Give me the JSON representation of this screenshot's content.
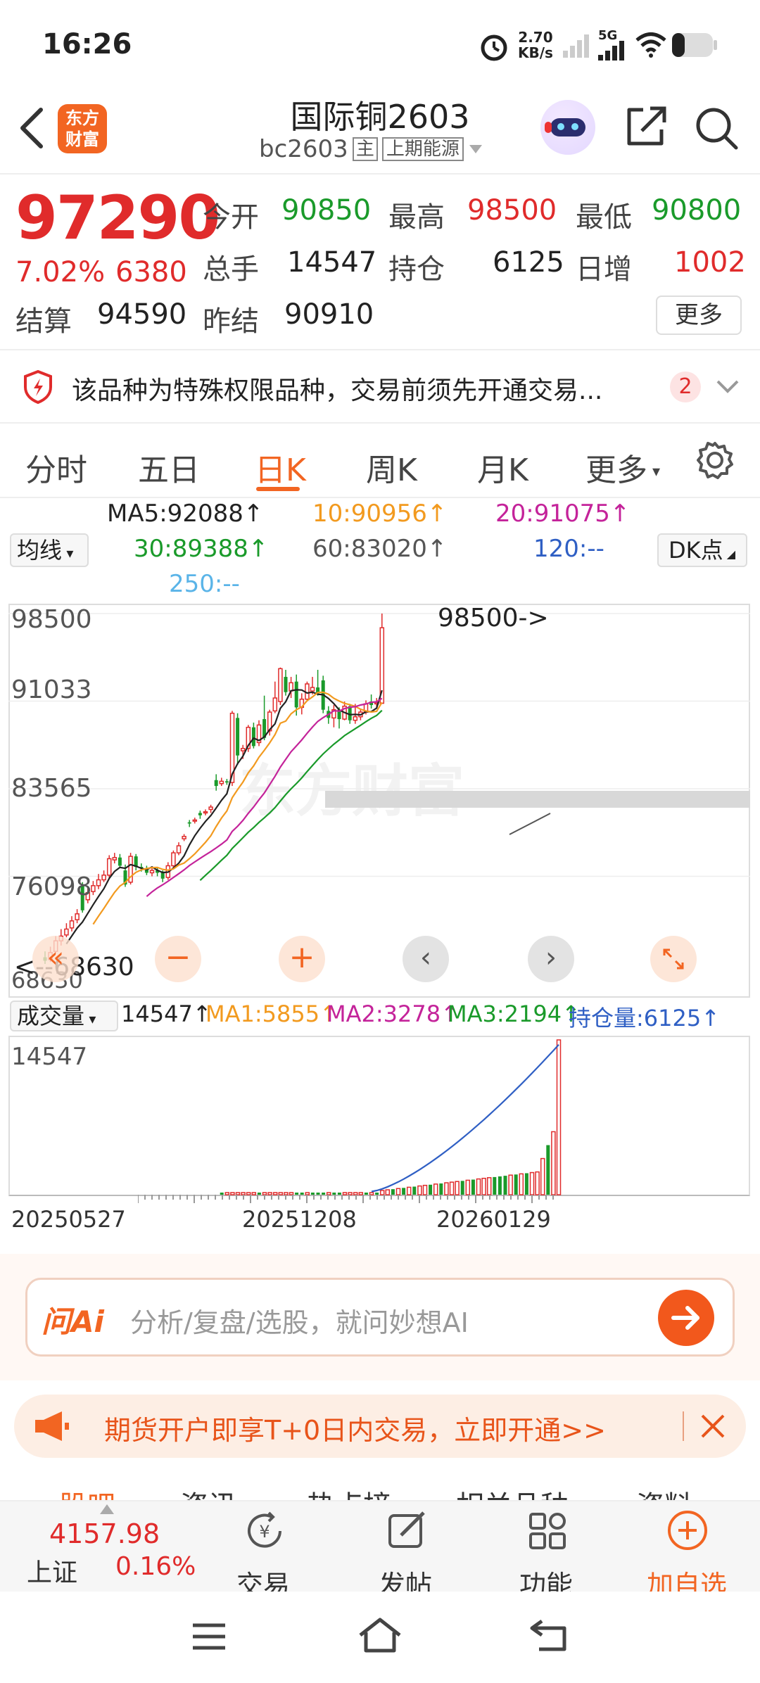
{
  "status": {
    "time": "16:26",
    "net_speed": "2.70",
    "net_unit": "KB/s",
    "network": "5G"
  },
  "header": {
    "title": "国际铜2603",
    "code": "bc2603",
    "main_tag": "主",
    "exchange": "上期能源"
  },
  "quote": {
    "price": "97290",
    "change_pct": "7.02%",
    "change": "6380",
    "open_label": "今开",
    "open": "90850",
    "high_label": "最高",
    "high": "98500",
    "low_label": "最低",
    "low": "90800",
    "vol_label": "总手",
    "vol": "14547",
    "oi_label": "持仓",
    "oi": "6125",
    "inc_label": "日增",
    "inc": "1002",
    "settle_label": "结算",
    "settle": "94590",
    "prev_label": "昨结",
    "prev": "90910",
    "more_label": "更多"
  },
  "notice": {
    "text": "该品种为特殊权限品种，交易前须先开通交易...",
    "count": "2"
  },
  "tabs": [
    "分时",
    "五日",
    "日K",
    "周K",
    "月K",
    "更多"
  ],
  "ma": {
    "dropdown": "均线",
    "ma5": "MA5:92088↑",
    "ma10": "10:90956↑",
    "ma20": "20:91075↑",
    "ma30": "30:89388↑",
    "ma60": "60:83020↑",
    "ma120": "120:--",
    "ma250": "250:--",
    "dk": "DK点"
  },
  "price_axis": {
    "p1": "98500",
    "p2": "91033",
    "p3": "83565",
    "p4": "76098",
    "p5": "68630",
    "max_note": "98500->",
    "min_note": "<--68630"
  },
  "volume": {
    "dropdown": "成交量",
    "vol": "14547↑",
    "ma1": "MA1:5855↑",
    "ma2": "MA2:3278↑",
    "ma3": "MA3:2194↑",
    "oi": "持仓量:6125↑",
    "axis_max": "14547",
    "dates": [
      "20250527",
      "20251208",
      "20260129"
    ]
  },
  "ai": {
    "logo": "问Ai",
    "placeholder": "分析/复盘/选股，就问妙想AI"
  },
  "promo": {
    "text": "期货开户即享T+0日内交易，立即开通>>"
  },
  "subtabs": [
    "股吧",
    "资讯",
    "热点榜",
    "相关品种",
    "资料"
  ],
  "bottom": {
    "index_value": "4157.98",
    "index_name": "上证",
    "index_change": "0.16%",
    "trade": "交易",
    "post": "发帖",
    "func": "功能",
    "fav": "加自选"
  },
  "colors": {
    "up": "#e02b2b",
    "down": "#1a9a2a",
    "accent": "#f26522"
  },
  "chart_data": {
    "type": "candlestick",
    "y_range": [
      68630,
      98500
    ],
    "candles": [
      {
        "o": 69200,
        "c": 68900,
        "h": 69700,
        "l": 68630
      },
      {
        "o": 69000,
        "c": 69600,
        "h": 70100,
        "l": 68800
      },
      {
        "o": 69700,
        "c": 70600,
        "h": 71000,
        "l": 69500
      },
      {
        "o": 70600,
        "c": 71000,
        "h": 71600,
        "l": 70200
      },
      {
        "o": 71100,
        "c": 71600,
        "h": 72100,
        "l": 70900
      },
      {
        "o": 71700,
        "c": 72300,
        "h": 72700,
        "l": 71400
      },
      {
        "o": 72400,
        "c": 72900,
        "h": 73300,
        "l": 72100
      },
      {
        "o": 75300,
        "c": 73200,
        "h": 75600,
        "l": 73000
      },
      {
        "o": 74100,
        "c": 74700,
        "h": 75100,
        "l": 73800
      },
      {
        "o": 74800,
        "c": 75300,
        "h": 75700,
        "l": 74500
      },
      {
        "o": 75300,
        "c": 75800,
        "h": 76300,
        "l": 75000
      },
      {
        "o": 75800,
        "c": 76200,
        "h": 76600,
        "l": 75600
      },
      {
        "o": 76200,
        "c": 77600,
        "h": 77900,
        "l": 75900
      },
      {
        "o": 77500,
        "c": 77700,
        "h": 78100,
        "l": 77200
      },
      {
        "o": 77700,
        "c": 77000,
        "h": 78000,
        "l": 76800
      },
      {
        "o": 76600,
        "c": 75400,
        "h": 77100,
        "l": 75200
      },
      {
        "o": 75600,
        "c": 77800,
        "h": 78100,
        "l": 75400
      },
      {
        "o": 77800,
        "c": 76900,
        "h": 78000,
        "l": 76600
      },
      {
        "o": 76900,
        "c": 76800,
        "h": 77200,
        "l": 76500
      },
      {
        "o": 76800,
        "c": 76400,
        "h": 77000,
        "l": 76200
      },
      {
        "o": 76400,
        "c": 76600,
        "h": 76900,
        "l": 76100
      },
      {
        "o": 76600,
        "c": 76400,
        "h": 76800,
        "l": 76100
      },
      {
        "o": 76500,
        "c": 75900,
        "h": 76600,
        "l": 75600
      },
      {
        "o": 76000,
        "c": 77000,
        "h": 77300,
        "l": 75800
      },
      {
        "o": 77000,
        "c": 78100,
        "h": 78300,
        "l": 76800
      },
      {
        "o": 78100,
        "c": 78700,
        "h": 79000,
        "l": 77900
      },
      {
        "o": 79300,
        "c": 79500,
        "h": 79700,
        "l": 79100
      },
      {
        "o": 80700,
        "c": 80600,
        "h": 80900,
        "l": 80300
      },
      {
        "o": 80800,
        "c": 80900,
        "h": 81100,
        "l": 80600
      },
      {
        "o": 81500,
        "c": 81300,
        "h": 81700,
        "l": 81000
      },
      {
        "o": 81500,
        "c": 81600,
        "h": 81800,
        "l": 81300
      },
      {
        "o": 81800,
        "c": 82000,
        "h": 82200,
        "l": 81500
      },
      {
        "o": 84300,
        "c": 83800,
        "h": 84800,
        "l": 83400
      },
      {
        "o": 84000,
        "c": 84200,
        "h": 84500,
        "l": 83800
      },
      {
        "o": 84200,
        "c": 84100,
        "h": 84400,
        "l": 83900
      },
      {
        "o": 84100,
        "c": 90000,
        "h": 90200,
        "l": 83800
      },
      {
        "o": 89600,
        "c": 86400,
        "h": 90000,
        "l": 85600
      },
      {
        "o": 86800,
        "c": 87000,
        "h": 87300,
        "l": 86100
      },
      {
        "o": 87000,
        "c": 88800,
        "h": 89000,
        "l": 86700
      },
      {
        "o": 88800,
        "c": 87200,
        "h": 89200,
        "l": 87000
      },
      {
        "o": 87500,
        "c": 89000,
        "h": 89400,
        "l": 87200
      },
      {
        "o": 89500,
        "c": 87900,
        "h": 91500,
        "l": 87700
      },
      {
        "o": 88500,
        "c": 90100,
        "h": 90300,
        "l": 88100
      },
      {
        "o": 90200,
        "c": 91300,
        "h": 92700,
        "l": 90000
      },
      {
        "o": 91000,
        "c": 93800,
        "h": 93900,
        "l": 90700
      },
      {
        "o": 93100,
        "c": 91800,
        "h": 93700,
        "l": 91500
      },
      {
        "o": 91900,
        "c": 92600,
        "h": 93100,
        "l": 91300
      },
      {
        "o": 92700,
        "c": 90500,
        "h": 93300,
        "l": 89800
      },
      {
        "o": 90500,
        "c": 91200,
        "h": 91700,
        "l": 89900
      },
      {
        "o": 91200,
        "c": 92500,
        "h": 92700,
        "l": 91000
      },
      {
        "o": 91900,
        "c": 92200,
        "h": 93100,
        "l": 91600
      },
      {
        "o": 92200,
        "c": 91700,
        "h": 93700,
        "l": 91500
      },
      {
        "o": 92800,
        "c": 90300,
        "h": 93200,
        "l": 90000
      },
      {
        "o": 90200,
        "c": 89600,
        "h": 90600,
        "l": 89100
      },
      {
        "o": 89600,
        "c": 90300,
        "h": 90700,
        "l": 88800
      },
      {
        "o": 90300,
        "c": 89500,
        "h": 90500,
        "l": 88700
      },
      {
        "o": 89500,
        "c": 90600,
        "h": 91000,
        "l": 89400
      },
      {
        "o": 90600,
        "c": 89400,
        "h": 90800,
        "l": 89100
      },
      {
        "o": 89400,
        "c": 89700,
        "h": 90800,
        "l": 89100
      },
      {
        "o": 89700,
        "c": 90100,
        "h": 90400,
        "l": 89400
      },
      {
        "o": 90100,
        "c": 90800,
        "h": 91100,
        "l": 89900
      },
      {
        "o": 91000,
        "c": 90700,
        "h": 91600,
        "l": 90400
      },
      {
        "o": 90800,
        "c": 90900,
        "h": 91300,
        "l": 90500
      },
      {
        "o": 90850,
        "c": 97290,
        "h": 98500,
        "l": 90800
      }
    ]
  }
}
